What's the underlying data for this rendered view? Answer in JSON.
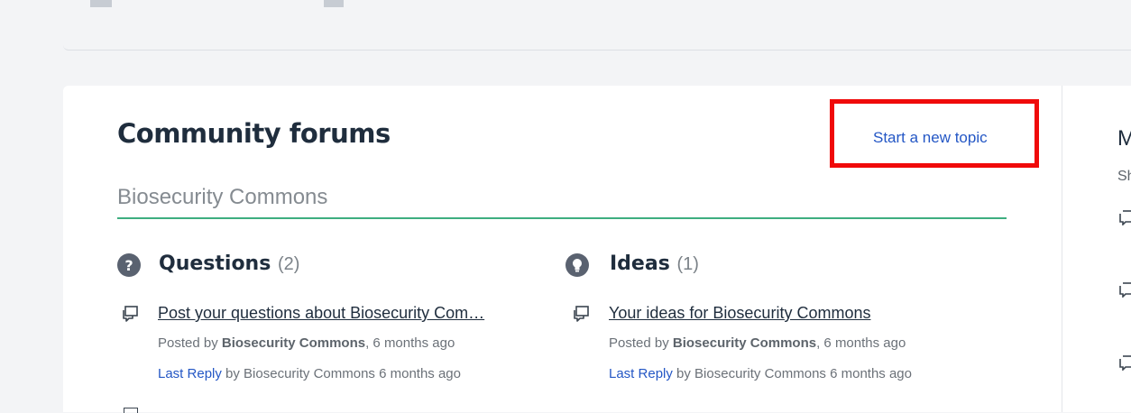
{
  "page": {
    "title": "Community forums",
    "new_topic_link": "Start a new topic",
    "subtitle": "Biosecurity Commons"
  },
  "categories": [
    {
      "icon": "question-icon",
      "icon_glyph": "?",
      "name": "Questions",
      "count": "(2)",
      "topic": {
        "title": "Post your questions about Biosecurity Com…",
        "posted_prefix": "Posted by",
        "author": "Biosecurity Commons",
        "posted_suffix": ", 6 months ago",
        "last_reply_link": "Last Reply",
        "last_reply_text": " by Biosecurity Commons 6 months ago"
      }
    },
    {
      "icon": "lightbulb-icon",
      "name": "Ideas",
      "count": "(1)",
      "topic": {
        "title": "Your ideas for Biosecurity Commons",
        "posted_prefix": "Posted by",
        "author": "Biosecurity Commons",
        "posted_suffix": ", 6 months ago",
        "last_reply_link": "Last Reply",
        "last_reply_text": " by Biosecurity Commons 6 months ago"
      }
    }
  ],
  "side_panel": {
    "heading_partial": "M",
    "sub_partial": "Sh"
  },
  "colors": {
    "accent_link": "#2457c5",
    "underline": "#3eae80",
    "highlight": "#f00a0a"
  }
}
